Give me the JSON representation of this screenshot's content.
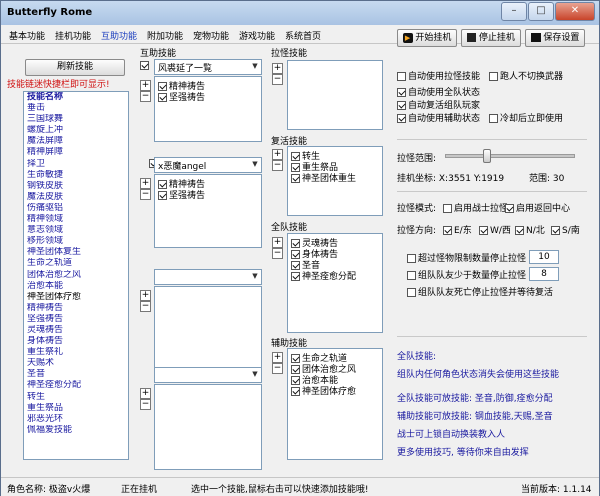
{
  "window": {
    "title": "Butterfly Rome",
    "min": "–",
    "max": "□",
    "close": "✕"
  },
  "menu": [
    "基本功能",
    "挂机功能",
    "互助功能",
    "附加功能",
    "宠物功能",
    "游戏功能",
    "系统首页"
  ],
  "left": {
    "refresh_btn": "刷新技能",
    "hint": "技能链迷快捷栏即可显示!",
    "list_header": "技能名称",
    "skills": [
      "垂击",
      "三国球舞",
      "螺旋上冲",
      "魔法屏障",
      "精神屏障",
      "择卫",
      "生命敏捷",
      "钢铁皮肤",
      "魔法皮肤",
      "伤痛驱铝",
      "精神领域",
      "意志领域",
      "移形领域",
      "神圣团体复生",
      "生命之轨道",
      "团体治愈之风",
      "治愈本能",
      "神圣团体疗愈",
      "精神祷告",
      "坚强祷告",
      "灵魂祷告",
      "身体祷告",
      "重生祭礼",
      "天赐术",
      "圣音",
      "神圣痊愈分配",
      "转生",
      "重生祭品",
      "邪恶光环",
      "佩福爱技能"
    ],
    "selected_index": 17
  },
  "mutual": {
    "title": "互助技能",
    "groups": [
      {
        "checked": true,
        "combo": "风裘延了一覧",
        "items": [
          {
            "label": "精神祷告",
            "checked": true
          },
          {
            "label": "坚强祷告",
            "checked": true
          }
        ]
      },
      {
        "checked": true,
        "combo": "x恶魔angel",
        "items": [
          {
            "label": "精神祷告",
            "checked": true
          },
          {
            "label": "坚强祷告",
            "checked": true
          }
        ]
      },
      {
        "checked": false,
        "combo": "",
        "items": []
      },
      {
        "checked": false,
        "combo": "",
        "items": []
      }
    ]
  },
  "pull_skills": {
    "title": "拉怪技能",
    "items": []
  },
  "revive": {
    "title": "复活技能",
    "items": [
      {
        "label": "转生",
        "checked": true
      },
      {
        "label": "重生祭品",
        "checked": true
      },
      {
        "label": "神圣团体重生",
        "checked": true
      }
    ]
  },
  "team": {
    "title": "全队技能",
    "items": [
      {
        "label": "灵魂祷告",
        "checked": true
      },
      {
        "label": "身体祷告",
        "checked": true
      },
      {
        "label": "圣音",
        "checked": true
      },
      {
        "label": "神圣痊愈分配",
        "checked": true
      }
    ]
  },
  "assist": {
    "title": "辅助技能",
    "items": [
      {
        "label": "生命之轨道",
        "checked": true
      },
      {
        "label": "团体治愈之风",
        "checked": true
      },
      {
        "label": "治愈本能",
        "checked": true
      },
      {
        "label": "神圣团体疗愈",
        "checked": true
      }
    ]
  },
  "top_buttons": {
    "start": "开始挂机",
    "stop": "停止挂机",
    "save": "保存设置"
  },
  "options": [
    {
      "label": "自动使用拉怪技能",
      "checked": false
    },
    {
      "label": "跑人不切换武器",
      "checked": false
    },
    {
      "label": "自动使用全队状态",
      "checked": true
    },
    {
      "label": "自动复活组队玩家",
      "checked": true
    },
    {
      "label": "自动使用辅助状态",
      "checked": true
    },
    {
      "label": "冷却后立即使用",
      "checked": false
    }
  ],
  "pull_range": {
    "label": "拉怪范围:",
    "fraction": 0.3
  },
  "coords": {
    "label": "挂机坐标: X:3551 Y:1919",
    "range_label": "范围: 30"
  },
  "pull_mode": {
    "label": "拉怪模式:",
    "opts": [
      {
        "label": "启用战士拉怪",
        "checked": false
      },
      {
        "label": "启用返回中心",
        "checked": true
      }
    ]
  },
  "pull_dir": {
    "label": "拉怪方向:",
    "opts": [
      {
        "label": "E/东",
        "checked": true
      },
      {
        "label": "W/西",
        "checked": true
      },
      {
        "label": "N/北",
        "checked": true
      },
      {
        "label": "S/南",
        "checked": true
      }
    ]
  },
  "limits": [
    {
      "label": "超过怪物限制数量停止拉怪",
      "checked": false,
      "value": "10"
    },
    {
      "label": "组队队友少于数量停止拉怪",
      "checked": false,
      "value": "8"
    },
    {
      "label": "组队队友死亡停止拉怪并等待复活",
      "checked": false
    }
  ],
  "info_lines": [
    "全队技能:",
    "组队内任何角色状态消失会使用这些技能",
    "全队技能可放技能: 圣音,防御,痊愈分配",
    "辅助技能可放技能: 钢血技能,天赐,圣音",
    "战士可上锁自动换装教入人",
    "更多使用技巧, 等待你来自由发挥"
  ],
  "status": {
    "role": "角色名称: 极盗v火爆",
    "state": "正在挂机",
    "tip": "选中一个技能,鼠标右击可以快速添加技能哦!",
    "version": "当前版本: 1.1.14"
  }
}
